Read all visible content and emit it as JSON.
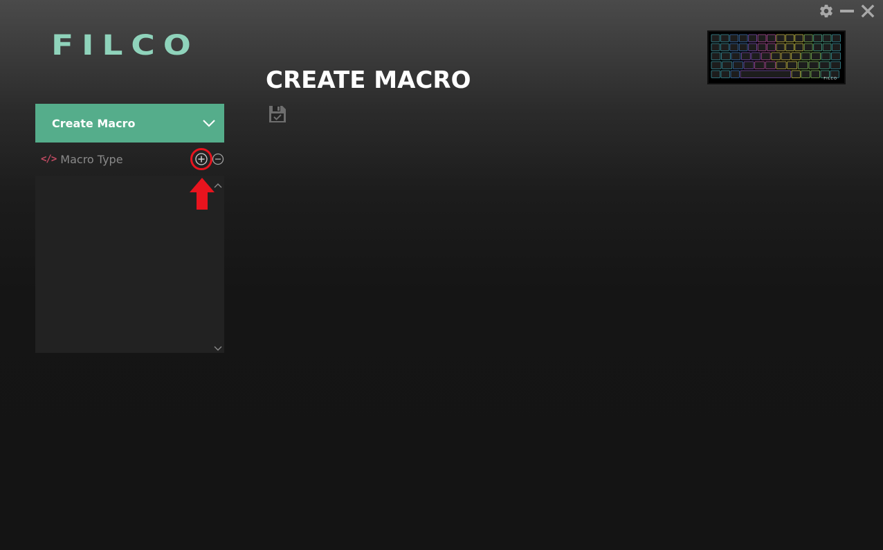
{
  "app": {
    "logo_text": "FILCO"
  },
  "window_controls": {
    "settings_icon": "gear-icon",
    "minimize_icon": "minimize-icon",
    "close_icon": "close-icon"
  },
  "header": {
    "title": "CREATE MACRO",
    "save_icon": "save-icon"
  },
  "keyboard_preview": {
    "brand_text": "FILCO"
  },
  "sidebar": {
    "dropdown_label": "Create Macro",
    "macro_type_label": "Macro Type",
    "code_icon_text": "</>",
    "add_icon": "plus-circle-icon",
    "remove_icon": "minus-circle-icon",
    "list_items": []
  },
  "colors": {
    "accent": "#55ad8b",
    "logo": "#8fd3bb",
    "code_icon": "#c24b63",
    "highlight": "#e8141e"
  }
}
